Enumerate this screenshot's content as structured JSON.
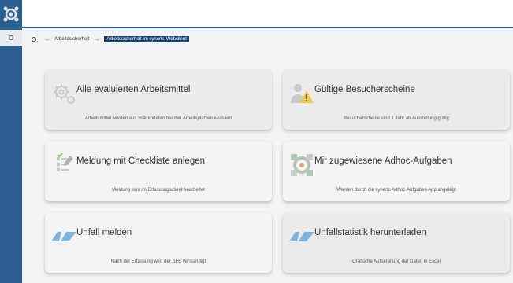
{
  "breadcrumb": {
    "items": [
      "Arbeitssicherheit",
      "Arbeitssicherheit im synerts-Webclient"
    ],
    "separator": "→"
  },
  "tiles": [
    {
      "title": "Alle evaluierten Arbeitsmittel",
      "description": "Arbeitsmittel werden aus Stammdaten bei den Arbeitsplätzen evaluiert",
      "icon": "gears-icon"
    },
    {
      "title": "Gültige Besucherscheine",
      "description": "Besucherscheine sind 1 Jahr ab Ausstellung gültig",
      "icon": "visitor-warning-icon"
    },
    {
      "title": "Meldung mit Checkliste anlegen",
      "description": "Meldung wird im Erfassungsclient bearbeitet",
      "icon": "checklist-icon"
    },
    {
      "title": "Mir zugewiesene Adhoc-Aufgaben",
      "description": "Werden durch die synerts Adhoc-Aufgaben App angelegt",
      "icon": "adhoc-tasks-icon"
    },
    {
      "title": "Unfall melden",
      "description": "Nach der Erfassung wird der SFK verständigt",
      "icon": "av-logo-icon"
    },
    {
      "title": "Unfallstatistik herunterladen",
      "description": "Grafische Aufbereitung der Daten in Excel",
      "icon": "av-logo-icon"
    }
  ],
  "colors": {
    "sidebar": "#2b5f8f",
    "breadcrumb_active": "#16406b",
    "av_logo": "#7fb3e0"
  }
}
